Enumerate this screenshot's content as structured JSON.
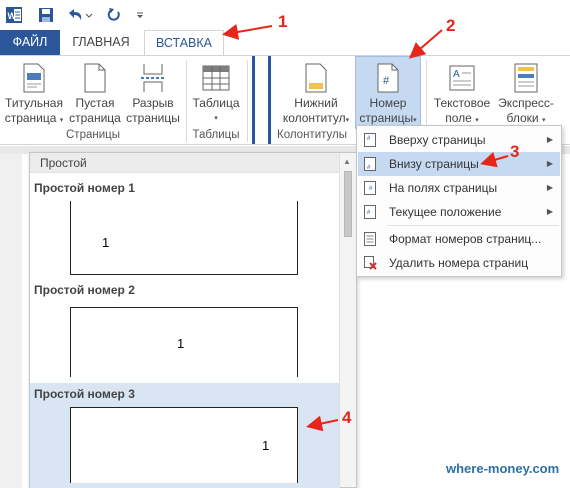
{
  "quick_access": {
    "word_icon": "word-logo-icon",
    "save_icon": "save-icon",
    "undo_icon": "undo-icon",
    "redo_icon": "redo-icon",
    "customize_icon": "customize-arrow-icon"
  },
  "tabs": {
    "file": "ФАЙЛ",
    "home": "ГЛАВНАЯ",
    "insert": "ВСТАВКА"
  },
  "ribbon": {
    "cover_page": [
      "Титульная",
      "страница"
    ],
    "blank_page": [
      "Пустая",
      "страница"
    ],
    "page_break": [
      "Разрыв",
      "страницы"
    ],
    "table": "Таблица",
    "footer": [
      "Нижний",
      "колонтитул"
    ],
    "page_number": [
      "Номер",
      "страницы"
    ],
    "text_box": [
      "Текстовое",
      "поле"
    ],
    "quick_parts": [
      "Экспресс-",
      "блоки"
    ],
    "groups": {
      "pages": "Страницы",
      "tables": "Таблицы",
      "header_footer": "Колонтитулы"
    }
  },
  "gallery": {
    "header": "Простой",
    "items": [
      {
        "title": "Простой номер 1",
        "number": "1"
      },
      {
        "title": "Простой номер 2",
        "number": "1"
      },
      {
        "title": "Простой номер 3",
        "number": "1"
      }
    ]
  },
  "menu": {
    "items": [
      {
        "label": "Вверху страницы",
        "has_submenu": true
      },
      {
        "label": "Внизу страницы",
        "has_submenu": true
      },
      {
        "label": "На полях страницы",
        "has_submenu": true
      },
      {
        "label": "Текущее положение",
        "has_submenu": true
      },
      {
        "label": "Формат номеров страниц...",
        "has_submenu": false
      },
      {
        "label": "Удалить номера страниц",
        "has_submenu": false
      }
    ]
  },
  "annotations": [
    "1",
    "2",
    "3",
    "4"
  ],
  "watermark": "where-money.com",
  "colors": {
    "accent": "#2b579a",
    "selection": "#c5d9f1",
    "annotation": "#e8251a",
    "watermark": "#2d6fa8"
  }
}
